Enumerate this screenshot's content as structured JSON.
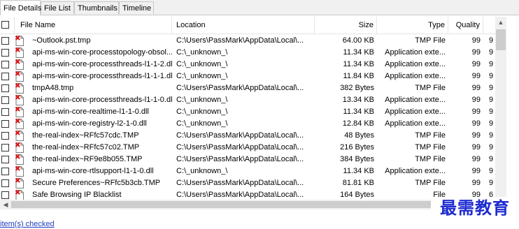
{
  "tabs": [
    {
      "label": "File Details",
      "active": true
    },
    {
      "label": "File List",
      "active": false
    },
    {
      "label": "Thumbnails",
      "active": false
    },
    {
      "label": "Timeline",
      "active": false
    }
  ],
  "columns": {
    "name": "File Name",
    "location": "Location",
    "size": "Size",
    "type": "Type",
    "quality": "Quality"
  },
  "rows": [
    {
      "name": "~Outlook.pst.tmp",
      "location": "C:\\Users\\PassMark\\AppData\\Local\\...",
      "size": "64.00 KB",
      "type": "TMP File",
      "quality": "99",
      "extra": "9"
    },
    {
      "name": "api-ms-win-core-processtopology-obsol...",
      "location": "C:\\_unknown_\\",
      "size": "11.34 KB",
      "type": "Application exte...",
      "quality": "99",
      "extra": "9"
    },
    {
      "name": "api-ms-win-core-processthreads-l1-1-2.dll",
      "location": "C:\\_unknown_\\",
      "size": "11.34 KB",
      "type": "Application exte...",
      "quality": "99",
      "extra": "9"
    },
    {
      "name": "api-ms-win-core-processthreads-l1-1-1.dll",
      "location": "C:\\_unknown_\\",
      "size": "11.84 KB",
      "type": "Application exte...",
      "quality": "99",
      "extra": "9"
    },
    {
      "name": "tmpA48.tmp",
      "location": "C:\\Users\\PassMark\\AppData\\Local\\...",
      "size": "382 Bytes",
      "type": "TMP File",
      "quality": "99",
      "extra": "9"
    },
    {
      "name": "api-ms-win-core-processthreads-l1-1-0.dll",
      "location": "C:\\_unknown_\\",
      "size": "13.34 KB",
      "type": "Application exte...",
      "quality": "99",
      "extra": "9"
    },
    {
      "name": "api-ms-win-core-realtime-l1-1-0.dll",
      "location": "C:\\_unknown_\\",
      "size": "11.34 KB",
      "type": "Application exte...",
      "quality": "99",
      "extra": "9"
    },
    {
      "name": "api-ms-win-core-registry-l2-1-0.dll",
      "location": "C:\\_unknown_\\",
      "size": "12.84 KB",
      "type": "Application exte...",
      "quality": "99",
      "extra": "9"
    },
    {
      "name": "the-real-index~RFfc57cdc.TMP",
      "location": "C:\\Users\\PassMark\\AppData\\Local\\...",
      "size": "48 Bytes",
      "type": "TMP File",
      "quality": "99",
      "extra": "9"
    },
    {
      "name": "the-real-index~RFfc57c02.TMP",
      "location": "C:\\Users\\PassMark\\AppData\\Local\\...",
      "size": "216 Bytes",
      "type": "TMP File",
      "quality": "99",
      "extra": "9"
    },
    {
      "name": "the-real-index~RF9e8b055.TMP",
      "location": "C:\\Users\\PassMark\\AppData\\Local\\...",
      "size": "384 Bytes",
      "type": "TMP File",
      "quality": "99",
      "extra": "9"
    },
    {
      "name": "api-ms-win-core-rtlsupport-l1-1-0.dll",
      "location": "C:\\_unknown_\\",
      "size": "11.34 KB",
      "type": "Application exte...",
      "quality": "99",
      "extra": "9"
    },
    {
      "name": "Secure Preferences~RFfc5b3cb.TMP",
      "location": "C:\\Users\\PassMark\\AppData\\Local\\...",
      "size": "81.81 KB",
      "type": "TMP File",
      "quality": "99",
      "extra": "9"
    },
    {
      "name": "Safe Browsing IP Blacklist",
      "location": "C:\\Users\\PassMark\\AppData\\Local\\...",
      "size": "164 Bytes",
      "type": "File",
      "quality": "99",
      "extra": "6"
    }
  ],
  "status": {
    "text": "item(s) checked"
  },
  "watermark": {
    "text": "最需教育"
  },
  "icons": {
    "file": "file-deleted-icon",
    "scroll_up": "scroll-up-arrow-icon",
    "scroll_left": "scroll-left-arrow-icon"
  }
}
